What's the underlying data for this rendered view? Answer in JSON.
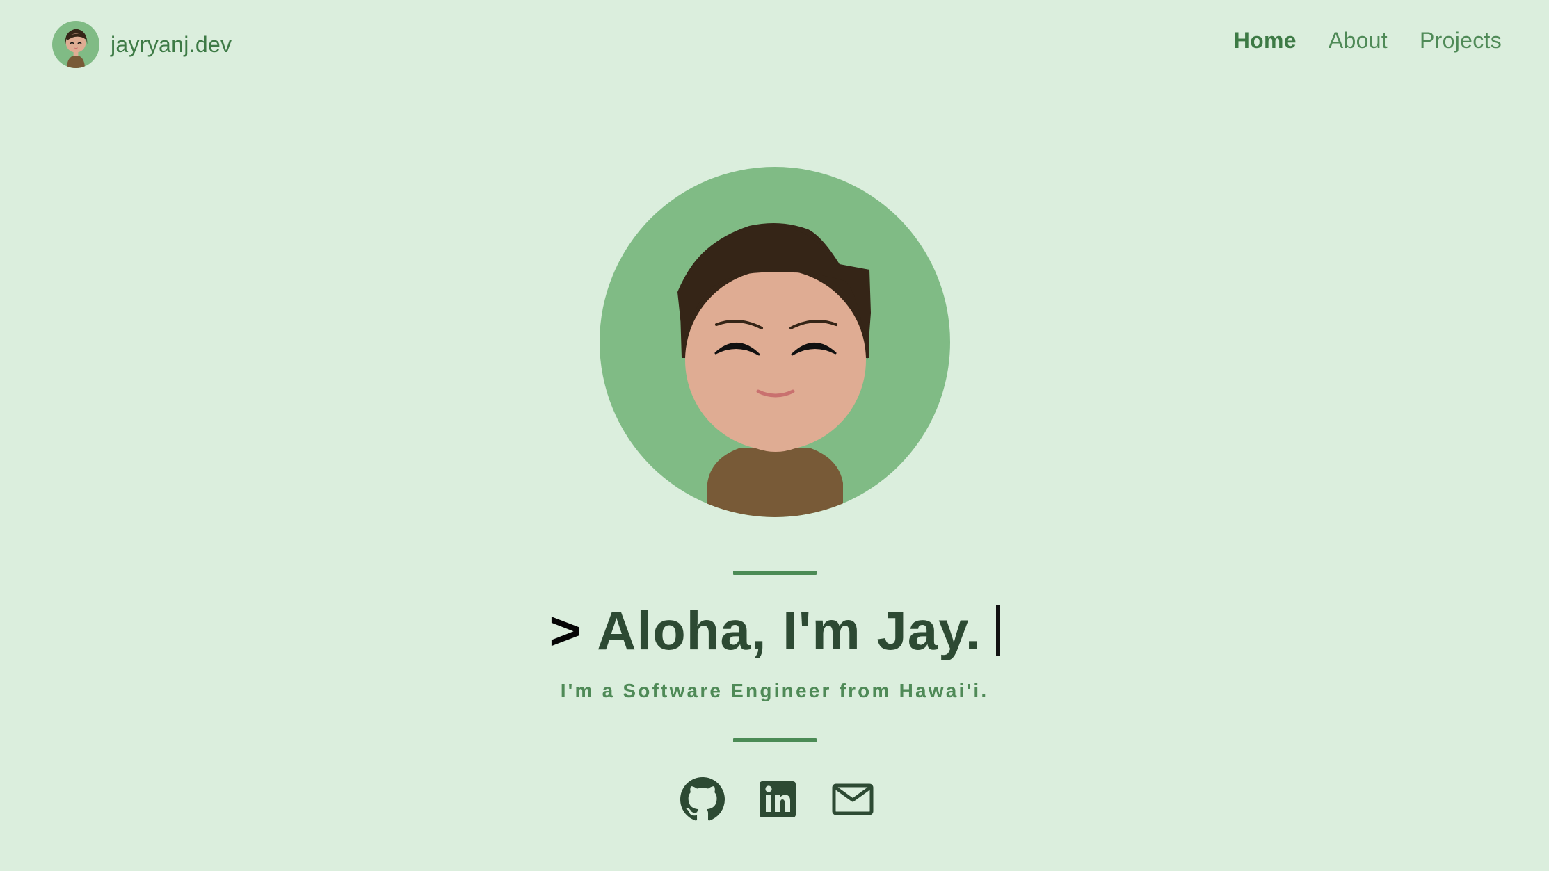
{
  "site": {
    "brand_name": "jayryanj.dev"
  },
  "nav": {
    "items": [
      {
        "label": "Home",
        "active": true
      },
      {
        "label": "About",
        "active": false
      },
      {
        "label": "Projects",
        "active": false
      }
    ]
  },
  "hero": {
    "prompt_symbol": ">",
    "headline": "Aloha, I'm Jay.",
    "subtitle": "I'm a Software Engineer from Hawai'i."
  },
  "socials": [
    {
      "name": "GitHub",
      "icon": "github-icon"
    },
    {
      "name": "LinkedIn",
      "icon": "linkedin-icon"
    },
    {
      "name": "Email",
      "icon": "mail-icon"
    }
  ],
  "colors": {
    "background": "#dbeedd",
    "accent": "#4b8b55",
    "avatar_circle": "#80bb85",
    "hair": "#352517",
    "skin": "#dfac93",
    "shirt": "#785a37",
    "headline": "#2d4a33"
  }
}
